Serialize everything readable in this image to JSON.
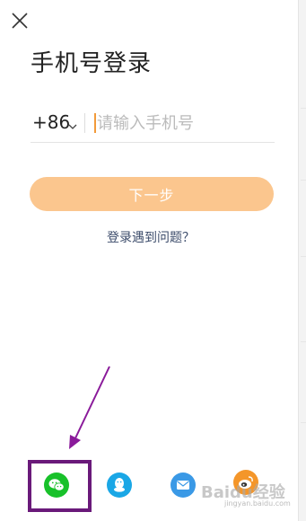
{
  "title": "手机号登录",
  "phone": {
    "country_code": "+86",
    "placeholder": "请输入手机号",
    "value": ""
  },
  "next_button": "下一步",
  "trouble_link": "登录遇到问题？",
  "social_login": [
    {
      "name": "wechat",
      "icon": "wechat-icon",
      "color": "#18c12a"
    },
    {
      "name": "qq",
      "icon": "qq-icon",
      "color": "#1aa7e6"
    },
    {
      "name": "email",
      "icon": "mail-icon",
      "color": "#3a99e6"
    },
    {
      "name": "weibo",
      "icon": "weibo-icon",
      "color": "#f4962a"
    }
  ],
  "annotation": {
    "arrow_color": "#8a1a9a",
    "box_color": "#6a1a7a"
  },
  "watermark": {
    "text": "Baidu经验",
    "url": "jingyan.baidu.com"
  },
  "colors": {
    "accent": "#fbc68e",
    "caret": "#f29a3a",
    "text": "#222222",
    "link": "#3b4b6a"
  }
}
